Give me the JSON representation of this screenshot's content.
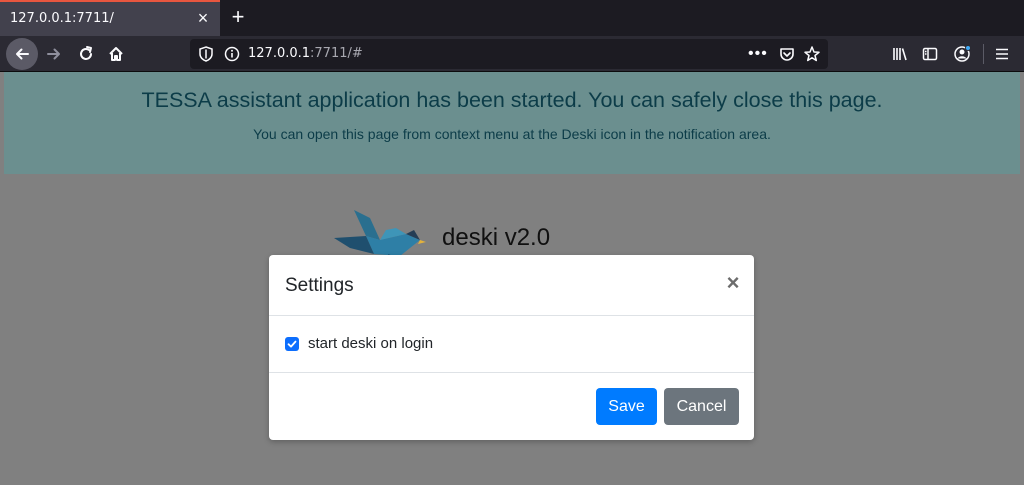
{
  "browser": {
    "tab": {
      "title": "127.0.0.1:7711/",
      "close_glyph": "×"
    },
    "new_tab_glyph": "+",
    "url": {
      "host": "127.0.0.1",
      "rest": ":7711/#"
    },
    "url_actions_glyph": "•••",
    "icons": [
      "back-icon",
      "forward-icon",
      "reload-icon",
      "home-icon",
      "shield-icon",
      "info-icon",
      "pocket-icon",
      "star-icon",
      "library-icon",
      "sidebar-icon",
      "account-icon",
      "menu-icon"
    ]
  },
  "page": {
    "banner": {
      "title": "TESSA assistant application has been started. You can safely close this page.",
      "subtitle": "You can open this page from context menu at the Deski icon in the notification area."
    },
    "app_title": "deski v2.0"
  },
  "modal": {
    "title": "Settings",
    "close_glyph": "×",
    "checkbox": {
      "label": "start deski on login",
      "checked": true
    },
    "save_label": "Save",
    "cancel_label": "Cancel"
  },
  "colors": {
    "accent": "#007bff",
    "secondary": "#6c757d",
    "banner": "#6b8f8f",
    "banner_text": "#0c3c48",
    "tab_highlight": "#e8563f"
  }
}
